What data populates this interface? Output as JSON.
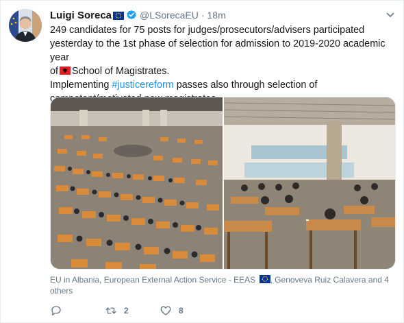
{
  "tweet": {
    "author_name": "Luigi Soreca",
    "handle": "@LSorecaEU",
    "separator": "·",
    "time": "18m",
    "text_line_1": "249 candidates for 75 posts for judges/prosecutors/advisers participated",
    "text_line_2": "yesterday to the 1st phase of selection for admission to 2019-2020 academic year",
    "text_line_3_pre": "of",
    "text_line_3_post": "School of Magistrates.",
    "text_line_4_pre": "Implementing",
    "hashtag": "#justicereform",
    "text_line_4_post": "passes also through selection of",
    "text_line_5": "competent/motivated new magistrates.",
    "tagged_line_1_pre": "EU in Albania, European External Action Service - EEAS",
    "tagged_line_1_post": ", Genoveva Ruiz Calavera and 4",
    "tagged_line_2": "others"
  },
  "actions": {
    "reply_count": "",
    "retweet_count": "2",
    "like_count": "8"
  },
  "icons": {
    "eu_flag": "eu-flag-icon",
    "albania_flag": "albania-flag-icon",
    "verified": "verified-badge-icon",
    "caret": "chevron-down-icon",
    "reply": "reply-icon",
    "retweet": "retweet-icon",
    "like": "heart-icon"
  },
  "colors": {
    "link": "#1b95e0",
    "muted": "#657786",
    "verified": "#1da1f2",
    "eu_blue": "#003399",
    "eu_gold": "#ffcc00",
    "albania_red": "#e41e20"
  }
}
